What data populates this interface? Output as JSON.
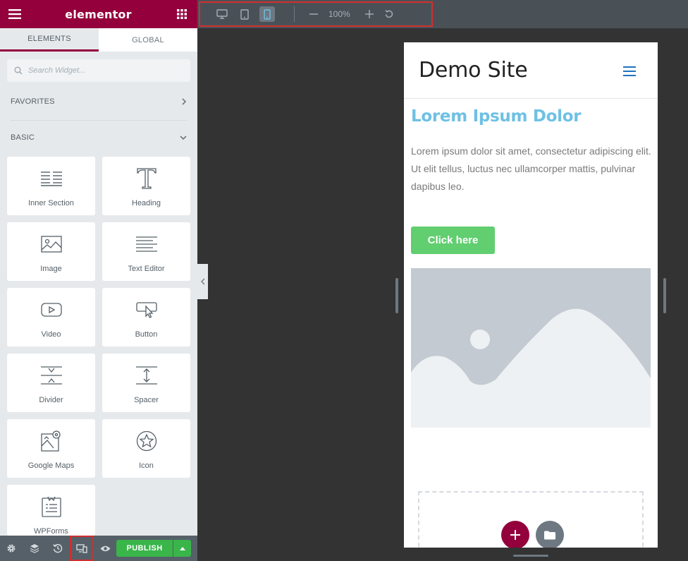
{
  "sidebar": {
    "logo": "elementor",
    "tabs": [
      {
        "label": "ELEMENTS"
      },
      {
        "label": "GLOBAL"
      }
    ],
    "search": {
      "placeholder": "Search Widget..."
    },
    "categories": {
      "favorites": "FAVORITES",
      "basic": "BASIC"
    },
    "widgets": [
      {
        "label": "Inner Section",
        "icon": "inner-section-icon"
      },
      {
        "label": "Heading",
        "icon": "heading-icon"
      },
      {
        "label": "Image",
        "icon": "image-icon"
      },
      {
        "label": "Text Editor",
        "icon": "text-editor-icon"
      },
      {
        "label": "Video",
        "icon": "video-icon"
      },
      {
        "label": "Button",
        "icon": "button-icon"
      },
      {
        "label": "Divider",
        "icon": "divider-icon"
      },
      {
        "label": "Spacer",
        "icon": "spacer-icon"
      },
      {
        "label": "Google Maps",
        "icon": "google-maps-icon"
      },
      {
        "label": "Icon",
        "icon": "star-icon"
      },
      {
        "label": "WPForms",
        "icon": "wpforms-icon"
      }
    ],
    "footer": {
      "publish_label": "PUBLISH"
    }
  },
  "topbar": {
    "zoom": "100%",
    "active_device": "mobile"
  },
  "preview": {
    "site_title": "Demo Site",
    "heading": "Lorem Ipsum Dolor",
    "text": "Lorem ipsum dolor sit amet, consectetur adipiscing elit. Ut elit tellus, luctus nec ullamcorper mattis, pulvinar dapibus leo.",
    "button_label": "Click here"
  },
  "colors": {
    "brand": "#93003c",
    "publish": "#39b54a",
    "heading": "#6ec1e4",
    "button": "#61ce70",
    "highlight": "#d22f2f"
  }
}
